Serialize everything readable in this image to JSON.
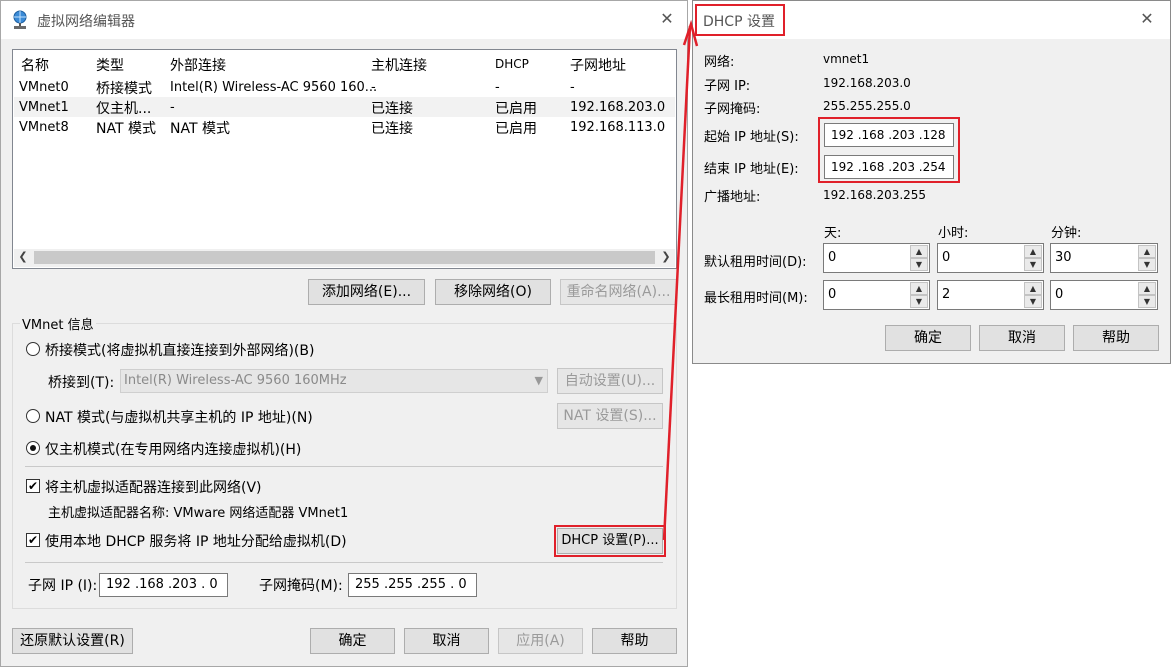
{
  "editor": {
    "title": "虚拟网络编辑器",
    "columns": [
      "名称",
      "类型",
      "外部连接",
      "主机连接",
      "DHCP",
      "子网地址"
    ],
    "rows": [
      {
        "name": "VMnet0",
        "type": "桥接模式",
        "external": "Intel(R) Wireless-AC 9560 160...",
        "host": "-",
        "dhcp": "-",
        "subnet": "-"
      },
      {
        "name": "VMnet1",
        "type": "仅主机...",
        "external": "-",
        "host": "已连接",
        "dhcp": "已启用",
        "subnet": "192.168.203.0"
      },
      {
        "name": "VMnet8",
        "type": "NAT 模式",
        "external": "NAT 模式",
        "host": "已连接",
        "dhcp": "已启用",
        "subnet": "192.168.113.0"
      }
    ],
    "add_network": "添加网络(E)...",
    "remove_network": "移除网络(O)",
    "rename_network": "重命名网络(A)...",
    "group_label": "VMnet 信息",
    "bridged_radio": "桥接模式(将虚拟机直接连接到外部网络)(B)",
    "bridged_to_label": "桥接到(T):",
    "bridged_to_value": "Intel(R) Wireless-AC 9560 160MHz",
    "auto_settings": "自动设置(U)...",
    "nat_radio": "NAT 模式(与虚拟机共享主机的 IP 地址)(N)",
    "nat_settings": "NAT 设置(S)...",
    "hostonly_radio": "仅主机模式(在专用网络内连接虚拟机)(H)",
    "connect_adapter": "将主机虚拟适配器连接到此网络(V)",
    "adapter_name": "主机虚拟适配器名称: VMware 网络适配器 VMnet1",
    "use_dhcp": "使用本地 DHCP 服务将 IP 地址分配给虚拟机(D)",
    "dhcp_settings": "DHCP 设置(P)...",
    "subnet_ip_label": "子网 IP (I):",
    "subnet_ip_value": "192 .168 .203 .  0",
    "subnet_mask_label": "子网掩码(M):",
    "subnet_mask_value": "255 .255 .255 .  0",
    "restore_defaults": "还原默认设置(R)",
    "ok": "确定",
    "cancel": "取消",
    "apply": "应用(A)",
    "help": "帮助"
  },
  "dhcp": {
    "title": "DHCP 设置",
    "network_label": "网络:",
    "network_value": "vmnet1",
    "subnet_ip_label": "子网 IP:",
    "subnet_ip_value": "192.168.203.0",
    "subnet_mask_label": "子网掩码:",
    "subnet_mask_value": "255.255.255.0",
    "start_ip_label": "起始 IP 地址(S):",
    "start_ip_value": "192 .168 .203 .128",
    "end_ip_label": "结束 IP 地址(E):",
    "end_ip_value": "192 .168 .203 .254",
    "broadcast_label": "广播地址:",
    "broadcast_value": "192.168.203.255",
    "days_label": "天:",
    "hours_label": "小时:",
    "minutes_label": "分钟:",
    "default_lease_label": "默认租用时间(D):",
    "default_lease": {
      "days": "0",
      "hours": "0",
      "minutes": "30"
    },
    "max_lease_label": "最长租用时间(M):",
    "max_lease": {
      "days": "0",
      "hours": "2",
      "minutes": "0"
    },
    "ok": "确定",
    "cancel": "取消",
    "help": "帮助"
  },
  "colors": {
    "highlight": "#e0202a"
  },
  "icons": {
    "app": "network-globe-icon",
    "close": "close-icon"
  }
}
